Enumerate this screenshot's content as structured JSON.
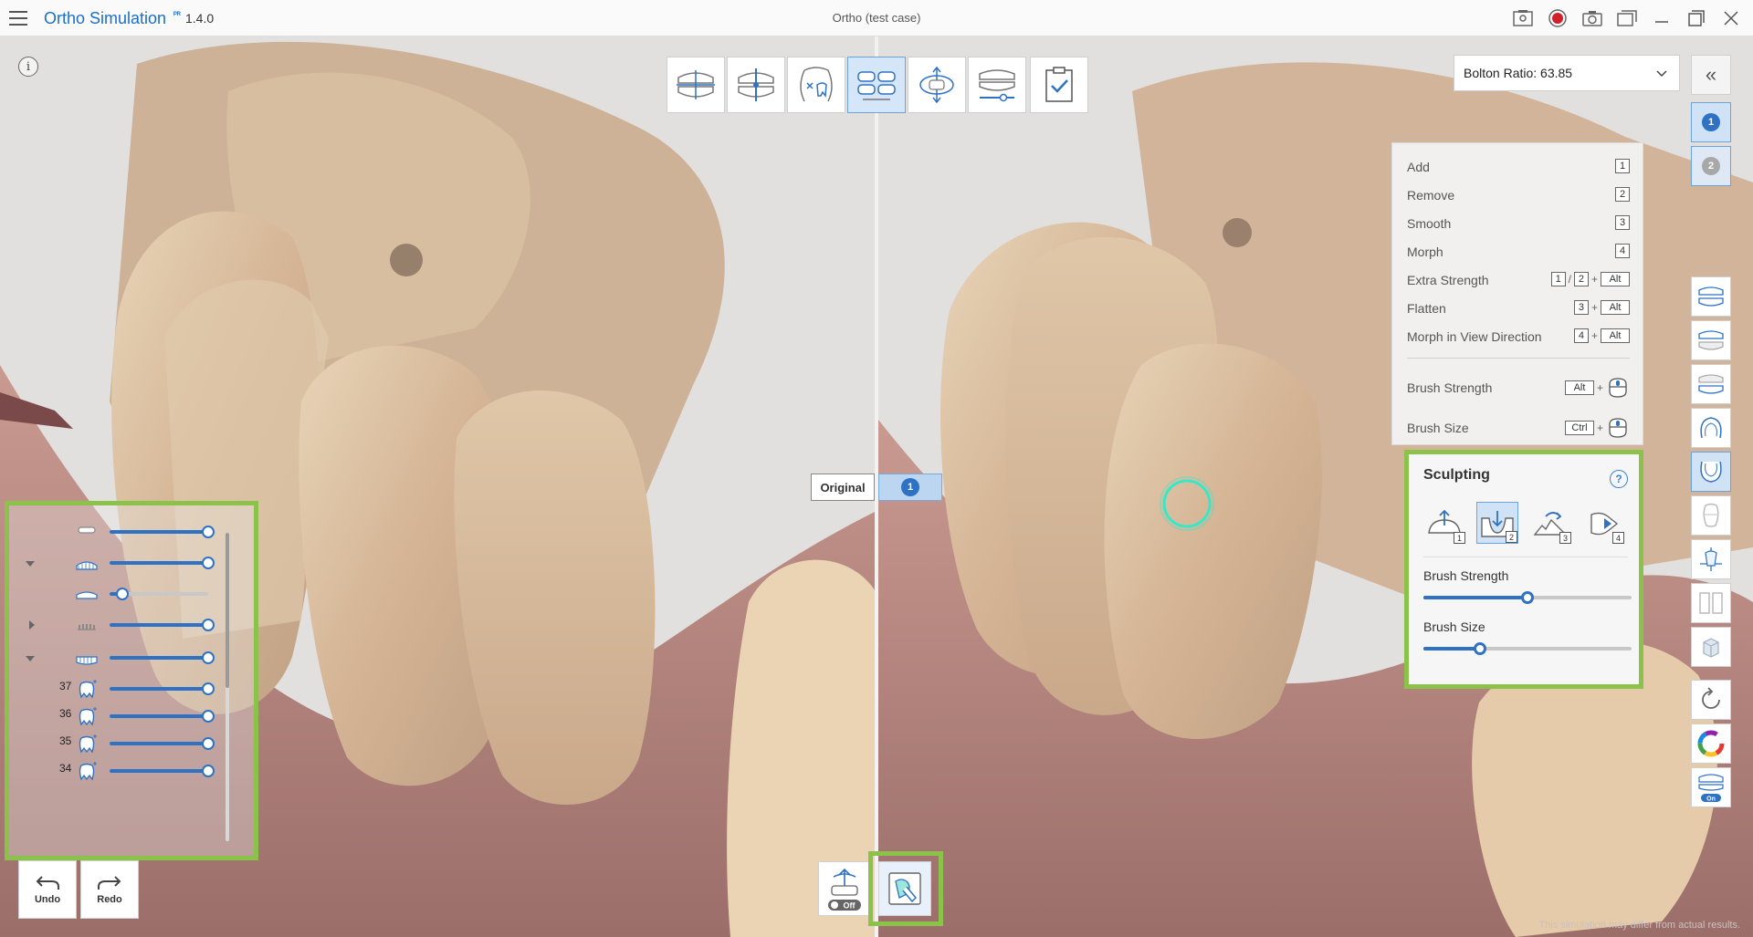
{
  "app": {
    "title": "Ortho Simulation",
    "badge": "ᴾᴿ",
    "version": "1.4.0",
    "case_title": "Ortho (test case)"
  },
  "window_controls": [
    "screenshot-icon",
    "record-icon",
    "camera-icon",
    "clone-window-icon",
    "minimize-icon",
    "maximize-icon",
    "close-icon"
  ],
  "top_toolbar": [
    "occlusion-tool-icon",
    "midline-tool-icon",
    "tooth-removal-icon",
    "bite-alignment-icon",
    "rotation-tool-icon",
    "stage-slider-icon",
    "checklist-icon"
  ],
  "bolton": {
    "label": "Bolton Ratio: 63.85"
  },
  "right_column": {
    "collapse": "«",
    "stage1": "1",
    "stage2": "2"
  },
  "shortcuts": {
    "add": {
      "label": "Add",
      "key": "1"
    },
    "remove": {
      "label": "Remove",
      "key": "2"
    },
    "smooth": {
      "label": "Smooth",
      "key": "3"
    },
    "morph": {
      "label": "Morph",
      "key": "4"
    },
    "extra_strength": {
      "label": "Extra Strength",
      "key1": "1",
      "slash": "/",
      "key2": "2",
      "plus": "+",
      "key3": "Alt"
    },
    "flatten": {
      "label": "Flatten",
      "key1": "3",
      "plus": "+",
      "key2": "Alt"
    },
    "morph_view": {
      "label": "Morph in View Direction",
      "key1": "4",
      "plus": "+",
      "key2": "Alt"
    },
    "brush_strength": {
      "label": "Brush Strength",
      "key": "Alt",
      "plus": "+"
    },
    "brush_size": {
      "label": "Brush Size",
      "key": "Ctrl",
      "plus": "+"
    }
  },
  "sculpting": {
    "title": "Sculpting",
    "help": "?",
    "tools": [
      {
        "name": "add",
        "key": "1"
      },
      {
        "name": "remove",
        "key": "2"
      },
      {
        "name": "smooth",
        "key": "3"
      },
      {
        "name": "morph",
        "key": "4"
      }
    ],
    "brush_strength_label": "Brush Strength",
    "brush_strength_value": 0.5,
    "brush_size_label": "Brush Size",
    "brush_size_value": 0.27
  },
  "view_labels": {
    "original": "Original",
    "stage": "1"
  },
  "layers": [
    {
      "arrow": "",
      "number": "",
      "value": 1.0
    },
    {
      "arrow": "down",
      "number": "",
      "value": 1.0
    },
    {
      "arrow": "",
      "number": "",
      "value": 0.13
    },
    {
      "arrow": "right",
      "number": "",
      "value": 1.0
    },
    {
      "arrow": "down",
      "number": "",
      "value": 1.0
    },
    {
      "arrow": "",
      "number": "37",
      "value": 1.0
    },
    {
      "arrow": "",
      "number": "36",
      "value": 1.0
    },
    {
      "arrow": "",
      "number": "35",
      "value": 1.0
    },
    {
      "arrow": "",
      "number": "34",
      "value": 1.0
    }
  ],
  "undo": "Undo",
  "redo": "Redo",
  "bottom_tools": {
    "align_toggle": "Off"
  },
  "disclaimer": "This simulation may differ from actual results."
}
